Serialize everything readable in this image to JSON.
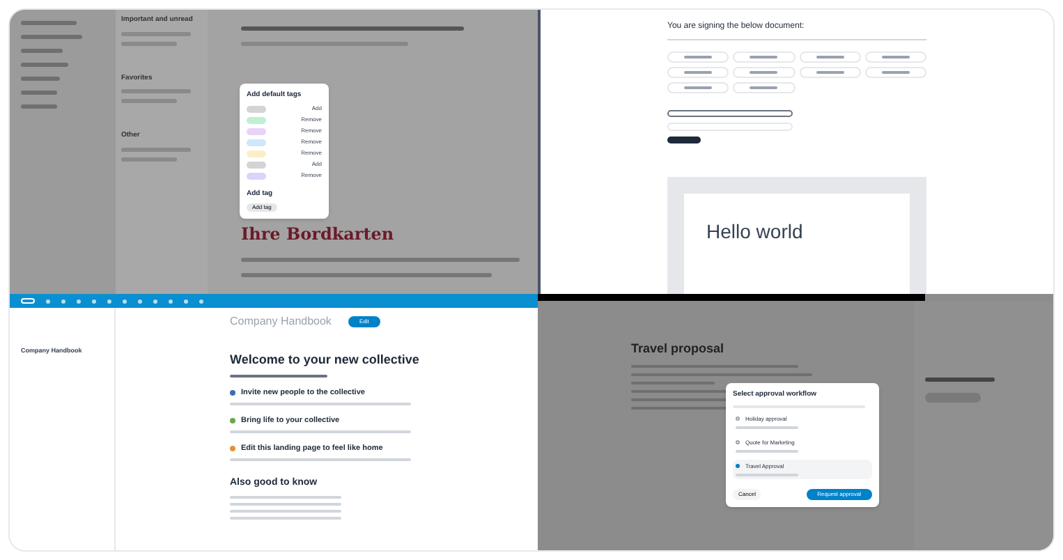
{
  "mail": {
    "sections": [
      {
        "title": "Important and unread"
      },
      {
        "title": "Favorites"
      },
      {
        "title": "Other"
      }
    ],
    "content_heading": "Ihre Bordkarten",
    "tag_dialog": {
      "title": "Add default tags",
      "tags": [
        {
          "color": "#d4d4d4",
          "action": "Add"
        },
        {
          "color": "#bff0d2",
          "action": "Remove"
        },
        {
          "color": "#ead2f7",
          "action": "Remove"
        },
        {
          "color": "#cfe6fb",
          "action": "Remove"
        },
        {
          "color": "#fbefc8",
          "action": "Remove"
        },
        {
          "color": "#d4d4d4",
          "action": "Add"
        },
        {
          "color": "#dcd2fb",
          "action": "Remove"
        }
      ],
      "add_title": "Add tag",
      "add_button": "Add tag"
    }
  },
  "signing": {
    "heading": "You are signing the below document:",
    "document_text": "Hello world"
  },
  "collectives": {
    "sidebar_item": "Company Handbook",
    "page_title": "Company Handbook",
    "edit_button": "Edit",
    "heading": "Welcome to your new collective",
    "sections": [
      {
        "title": "Invite new people to the collective",
        "color": "#3b6fb6"
      },
      {
        "title": "Bring life to your collective",
        "color": "#6aa84f"
      },
      {
        "title": "Edit this landing page to feel like home",
        "color": "#e69138"
      }
    ],
    "also_heading": "Also good to know"
  },
  "approval": {
    "doc_title": "Travel proposal",
    "dialog_title": "Select approval workflow",
    "workflows": [
      {
        "name": "Holiday approval",
        "selected": false
      },
      {
        "name": "Quote for Marketing",
        "selected": false
      },
      {
        "name": "Travel Approval",
        "selected": true
      }
    ],
    "cancel": "Cancel",
    "submit": "Request approval"
  }
}
